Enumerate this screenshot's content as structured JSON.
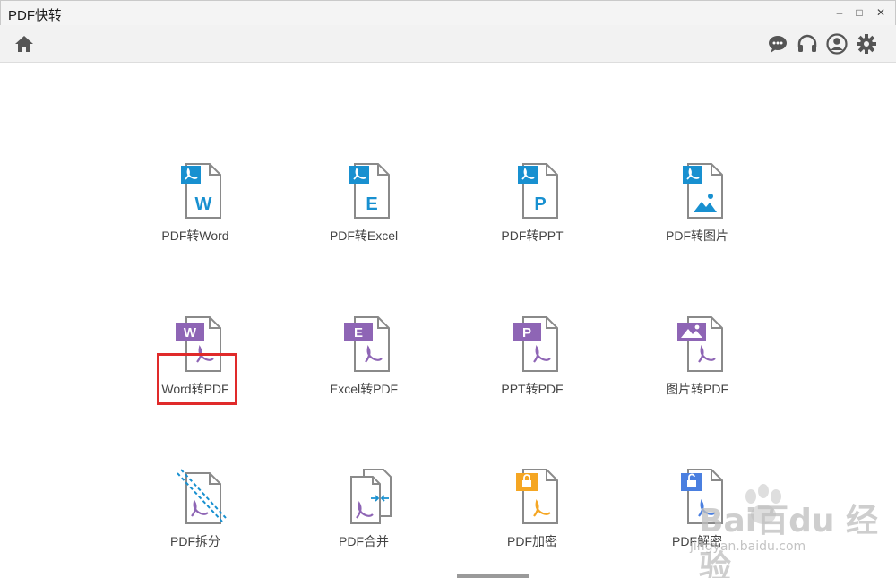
{
  "window": {
    "title": "PDF快转",
    "minimize": "–",
    "maximize": "□",
    "close": "✕"
  },
  "toolbar": {
    "left": [
      "home-icon"
    ],
    "right": [
      "chat-icon",
      "headphones-icon",
      "account-icon",
      "settings-icon"
    ]
  },
  "tiles": [
    {
      "label": "PDF转Word",
      "badge": "pdf",
      "letter": "W"
    },
    {
      "label": "PDF转Excel",
      "badge": "pdf",
      "letter": "E"
    },
    {
      "label": "PDF转PPT",
      "badge": "pdf",
      "letter": "P"
    },
    {
      "label": "PDF转图片",
      "badge": "pdf",
      "letter": "image"
    },
    {
      "label": "Word转PDF",
      "badge": "W",
      "letter": "pdf"
    },
    {
      "label": "Excel转PDF",
      "badge": "E",
      "letter": "pdf"
    },
    {
      "label": "PPT转PDF",
      "badge": "P",
      "letter": "pdf"
    },
    {
      "label": "图片转PDF",
      "badge": "image",
      "letter": "pdf"
    },
    {
      "label": "PDF拆分",
      "badge": "split",
      "letter": "pdf"
    },
    {
      "label": "PDF合并",
      "badge": "merge",
      "letter": "pdf"
    },
    {
      "label": "PDF加密",
      "badge": "lock",
      "letter": "pdf"
    },
    {
      "label": "PDF解密",
      "badge": "unlock",
      "letter": "pdf"
    }
  ],
  "colors": {
    "pdf_blue": "#1890d0",
    "purple": "#8e65b5",
    "lock_orange": "#f5a623",
    "unlock_blue": "#4a7fe0",
    "highlight_red": "#e02a2a"
  },
  "watermark": {
    "text": "Bai百du 经验",
    "sub": "jingyan.baidu.com"
  }
}
